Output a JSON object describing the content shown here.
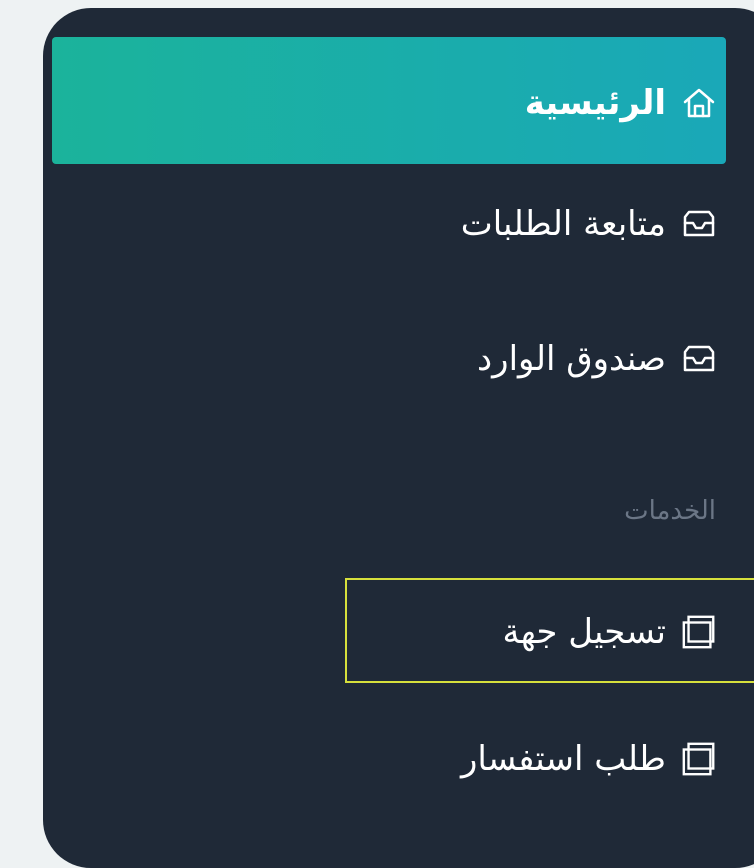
{
  "sidebar": {
    "active_item": {
      "label": "الرئيسية",
      "icon": "home-icon"
    },
    "items": [
      {
        "label": "متابعة الطلبات",
        "icon": "inbox-icon"
      },
      {
        "label": "صندوق الوارد",
        "icon": "inbox-icon"
      }
    ],
    "section_title": "الخدمات",
    "services": [
      {
        "label": "تسجيل جهة",
        "icon": "copy-icon"
      },
      {
        "label": "طلب استفسار",
        "icon": "copy-icon"
      }
    ]
  },
  "colors": {
    "page_background": "#eef2f3",
    "sidebar_background": "#1f2937",
    "active_gradient_start": "#1bb39b",
    "active_gradient_end": "#1aa8b8",
    "section_text": "#6b7686",
    "highlight_border": "#d6df3c"
  }
}
